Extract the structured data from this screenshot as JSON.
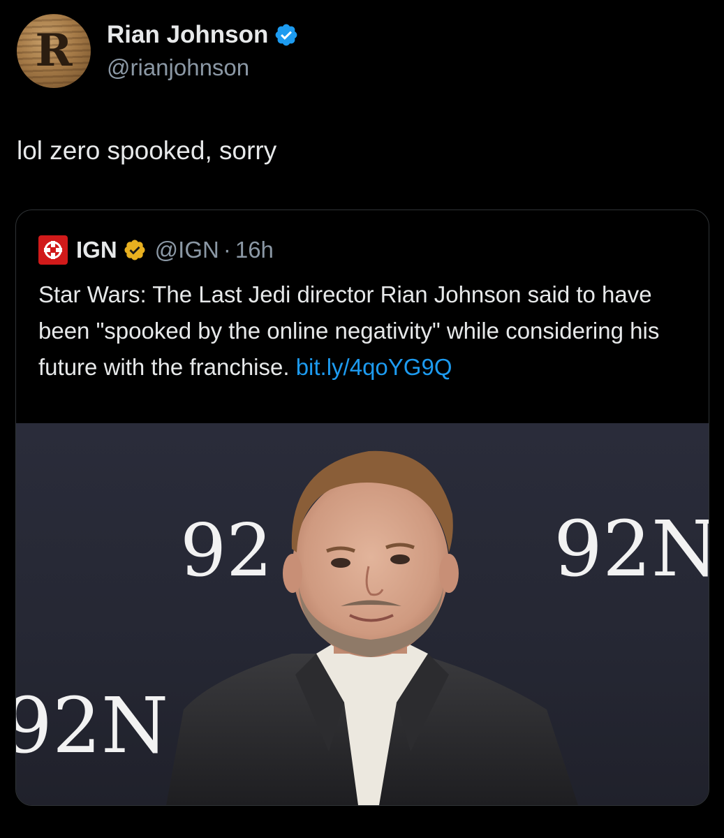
{
  "author": {
    "display_name": "Rian Johnson",
    "handle": "@rianjohnson",
    "avatar_letter": "R",
    "verified_color": "#1d9bf0"
  },
  "tweet": {
    "text": "lol zero spooked, sorry"
  },
  "quoted_tweet": {
    "name": "IGN",
    "handle": "@IGN",
    "separator": "·",
    "time": "16h",
    "logo_color": "#d11a1a",
    "verified_color": "#f4b400",
    "text": "Star Wars: The Last Jedi director Rian Johnson said to have been \"spooked by the online negativity\" while considering his future with the franchise.",
    "link": "bit.ly/4qoYG9Q",
    "image": {
      "backdrop_text": [
        "92",
        "92N",
        "92N"
      ]
    }
  }
}
